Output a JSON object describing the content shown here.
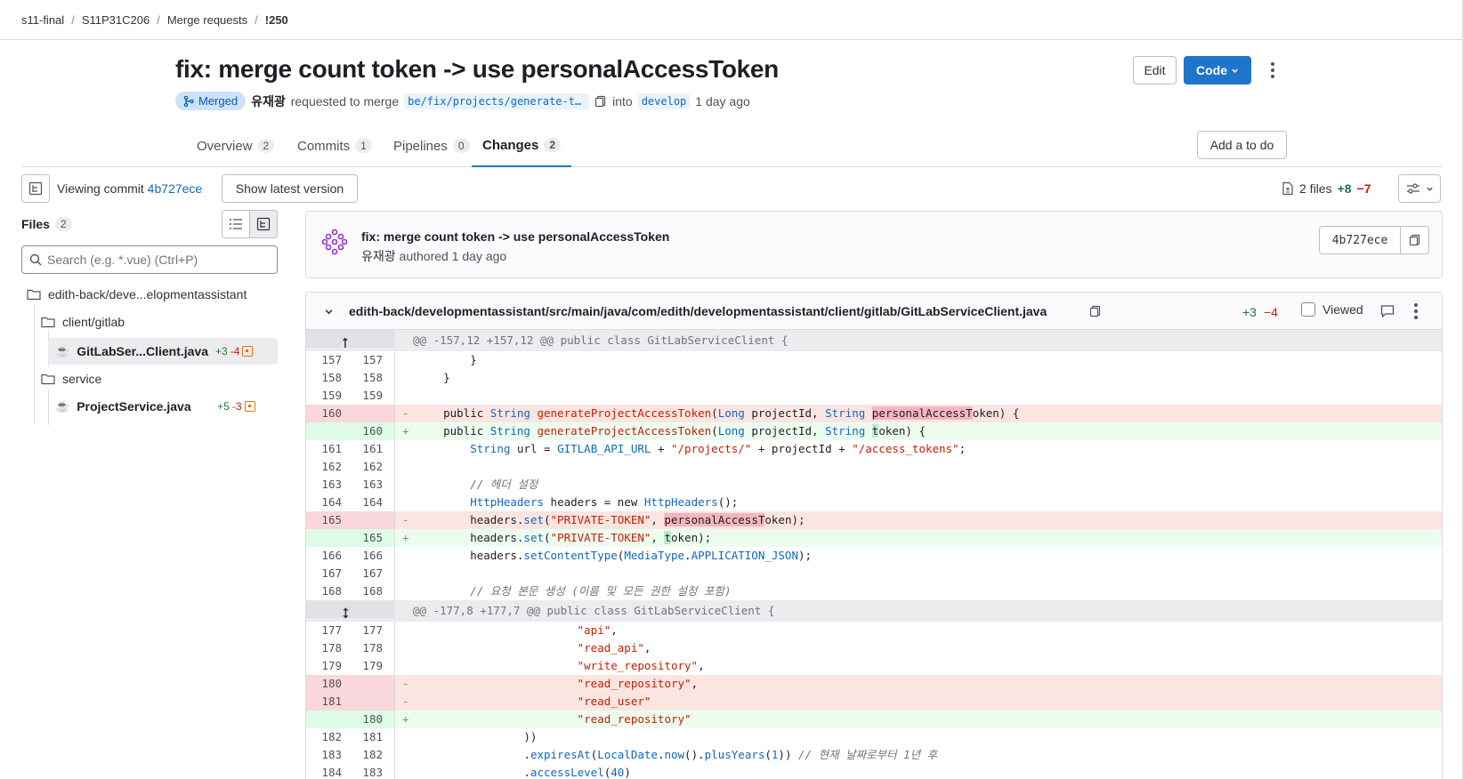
{
  "breadcrumb": [
    "s11-final",
    "S11P31C206",
    "Merge requests",
    "!250"
  ],
  "title": "fix: merge count token -> use personalAccessToken",
  "meta": {
    "status": "Merged",
    "author": "유재광",
    "requested_text": "requested to merge",
    "source_branch": "be/fix/projects/generate-t...",
    "into_text": "into",
    "target_branch": "develop",
    "time": "1 day ago"
  },
  "actions": {
    "edit": "Edit",
    "code": "Code",
    "add_todo": "Add a to do"
  },
  "tabs": [
    {
      "label": "Overview",
      "count": "2"
    },
    {
      "label": "Commits",
      "count": "1"
    },
    {
      "label": "Pipelines",
      "count": "0"
    },
    {
      "label": "Changes",
      "count": "2"
    }
  ],
  "commit_bar": {
    "viewing_label": "Viewing commit",
    "sha": "4b727ece",
    "show_latest": "Show latest version",
    "files_count": "2 files",
    "additions": "+8",
    "deletions": "−7"
  },
  "sidebar": {
    "title": "Files",
    "count": "2",
    "search_placeholder": "Search (e.g. *.vue) (Ctrl+P)",
    "tree": [
      {
        "label": "edith-back/deve...elopmentassistant"
      },
      {
        "label": "client/gitlab"
      },
      {
        "label": "GitLabSer...Client.java",
        "add": "+3",
        "del": "-4"
      },
      {
        "label": "service"
      },
      {
        "label": "ProjectService.java",
        "add": "+5",
        "del": "-3"
      }
    ]
  },
  "commit": {
    "title": "fix: merge count token -> use personalAccessToken",
    "author": "유재광",
    "authored": "authored 1 day ago",
    "sha": "4b727ece"
  },
  "diff": {
    "path": "edith-back/developmentassistant/src/main/java/com/edith/developmentassistant/client/gitlab/GitLabServiceClient.java",
    "additions": "+3",
    "deletions": "−4",
    "viewed_label": "Viewed",
    "hunk1": "@@ -157,12 +157,12 @@ public class GitLabServiceClient {",
    "hunk2": "@@ -177,8 +177,7 @@ public class GitLabServiceClient {"
  },
  "colors": {
    "accent": "#1f75cb",
    "merged_bg": "#cbe2f9",
    "add": "#217645",
    "del": "#c91c00"
  }
}
